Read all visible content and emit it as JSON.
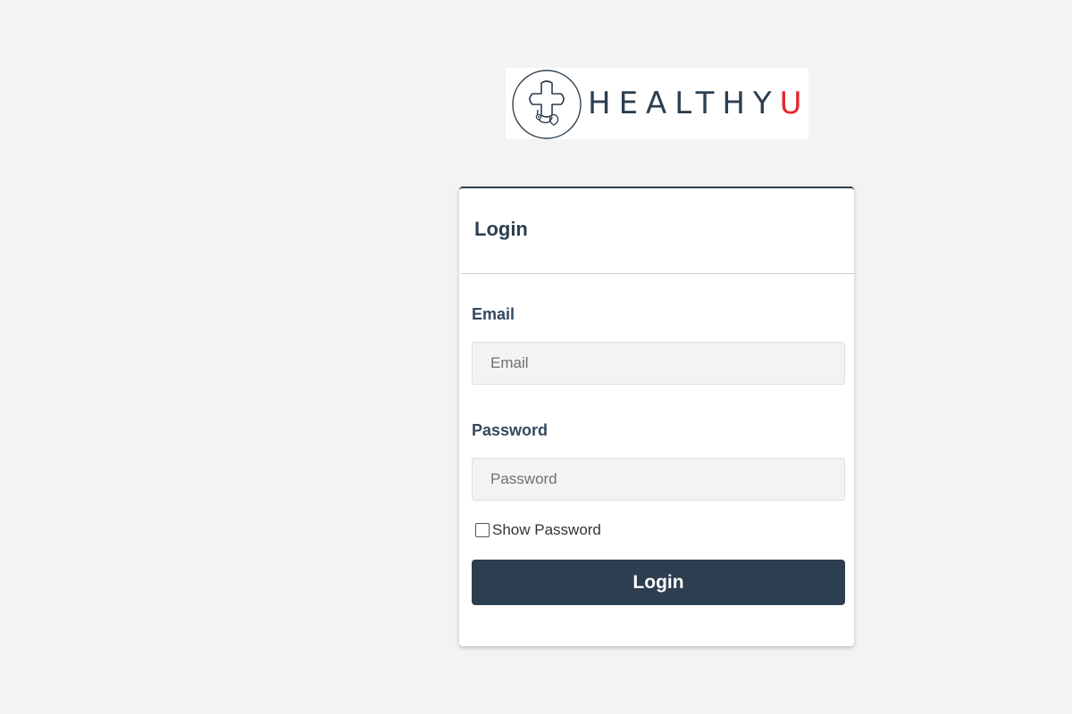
{
  "logo": {
    "text_main": "HEALTHY",
    "text_accent": "U",
    "accent_color": "#e8262f",
    "brand_color": "#2c3e50",
    "icon": "medical-cross-stethoscope-icon"
  },
  "card": {
    "title": "Login",
    "email": {
      "label": "Email",
      "placeholder": "Email",
      "value": ""
    },
    "password": {
      "label": "Password",
      "placeholder": "Password",
      "value": ""
    },
    "show_password": {
      "label": "Show Password",
      "checked": false
    },
    "submit_label": "Login"
  }
}
